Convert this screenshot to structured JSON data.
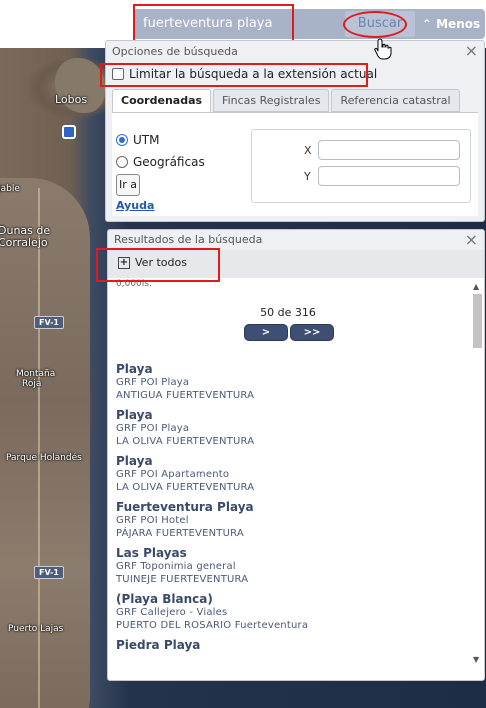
{
  "search": {
    "query": "fuerteventura playa",
    "button_label": "Buscar",
    "menos_label": "Menos"
  },
  "options": {
    "title": "Opciones de búsqueda",
    "limit_label": "Limitar la búsqueda a la extensión actual",
    "tabs": [
      "Coordenadas",
      "Fincas Registrales",
      "Referencia catastral"
    ],
    "radio_utm": "UTM",
    "radio_geo": "Geográficas",
    "ira_label": "Ir a",
    "ayuda_label": "Ayuda",
    "x_label": "X",
    "y_label": "Y"
  },
  "results": {
    "title": "Resultados de la búsqueda",
    "ver_todos": "Ver todos",
    "cut_text": "0,000ls.",
    "pager_text": "50 de 316",
    "next_label": ">",
    "last_label": ">>",
    "items": [
      {
        "title": "Playa",
        "type": "GRF POI Playa",
        "place": "ANTIGUA FUERTEVENTURA"
      },
      {
        "title": "Playa",
        "type": "GRF POI Playa",
        "place": "LA OLIVA FUERTEVENTURA"
      },
      {
        "title": "Playa",
        "type": "GRF POI Apartamento",
        "place": "LA OLIVA FUERTEVENTURA"
      },
      {
        "title": "Fuerteventura Playa",
        "type": "GRF POI Hotel",
        "place": "PÁJARA FUERTEVENTURA"
      },
      {
        "title": "Las Playas",
        "type": "GRF Toponimia general",
        "place": "TUINEJE FUERTEVENTURA"
      },
      {
        "title": "(Playa Blanca)",
        "type": "GRF Callejero - Viales",
        "place": "PUERTO DEL ROSARIO Fuerteventura"
      },
      {
        "title": "Piedra Playa",
        "type": "",
        "place": ""
      }
    ]
  },
  "map": {
    "labels": [
      "Lobos",
      "Dunas de",
      "Corralejo",
      "Jable",
      "Montaña",
      "Roja",
      "Parque Holandés",
      "Puerto Lajas"
    ],
    "road_tags": [
      "FV-1",
      "FV-1"
    ]
  },
  "colors": {
    "highlight": "#e01b1b",
    "searchbar": "#a9b3c8",
    "pager_button": "#3e4f73"
  }
}
